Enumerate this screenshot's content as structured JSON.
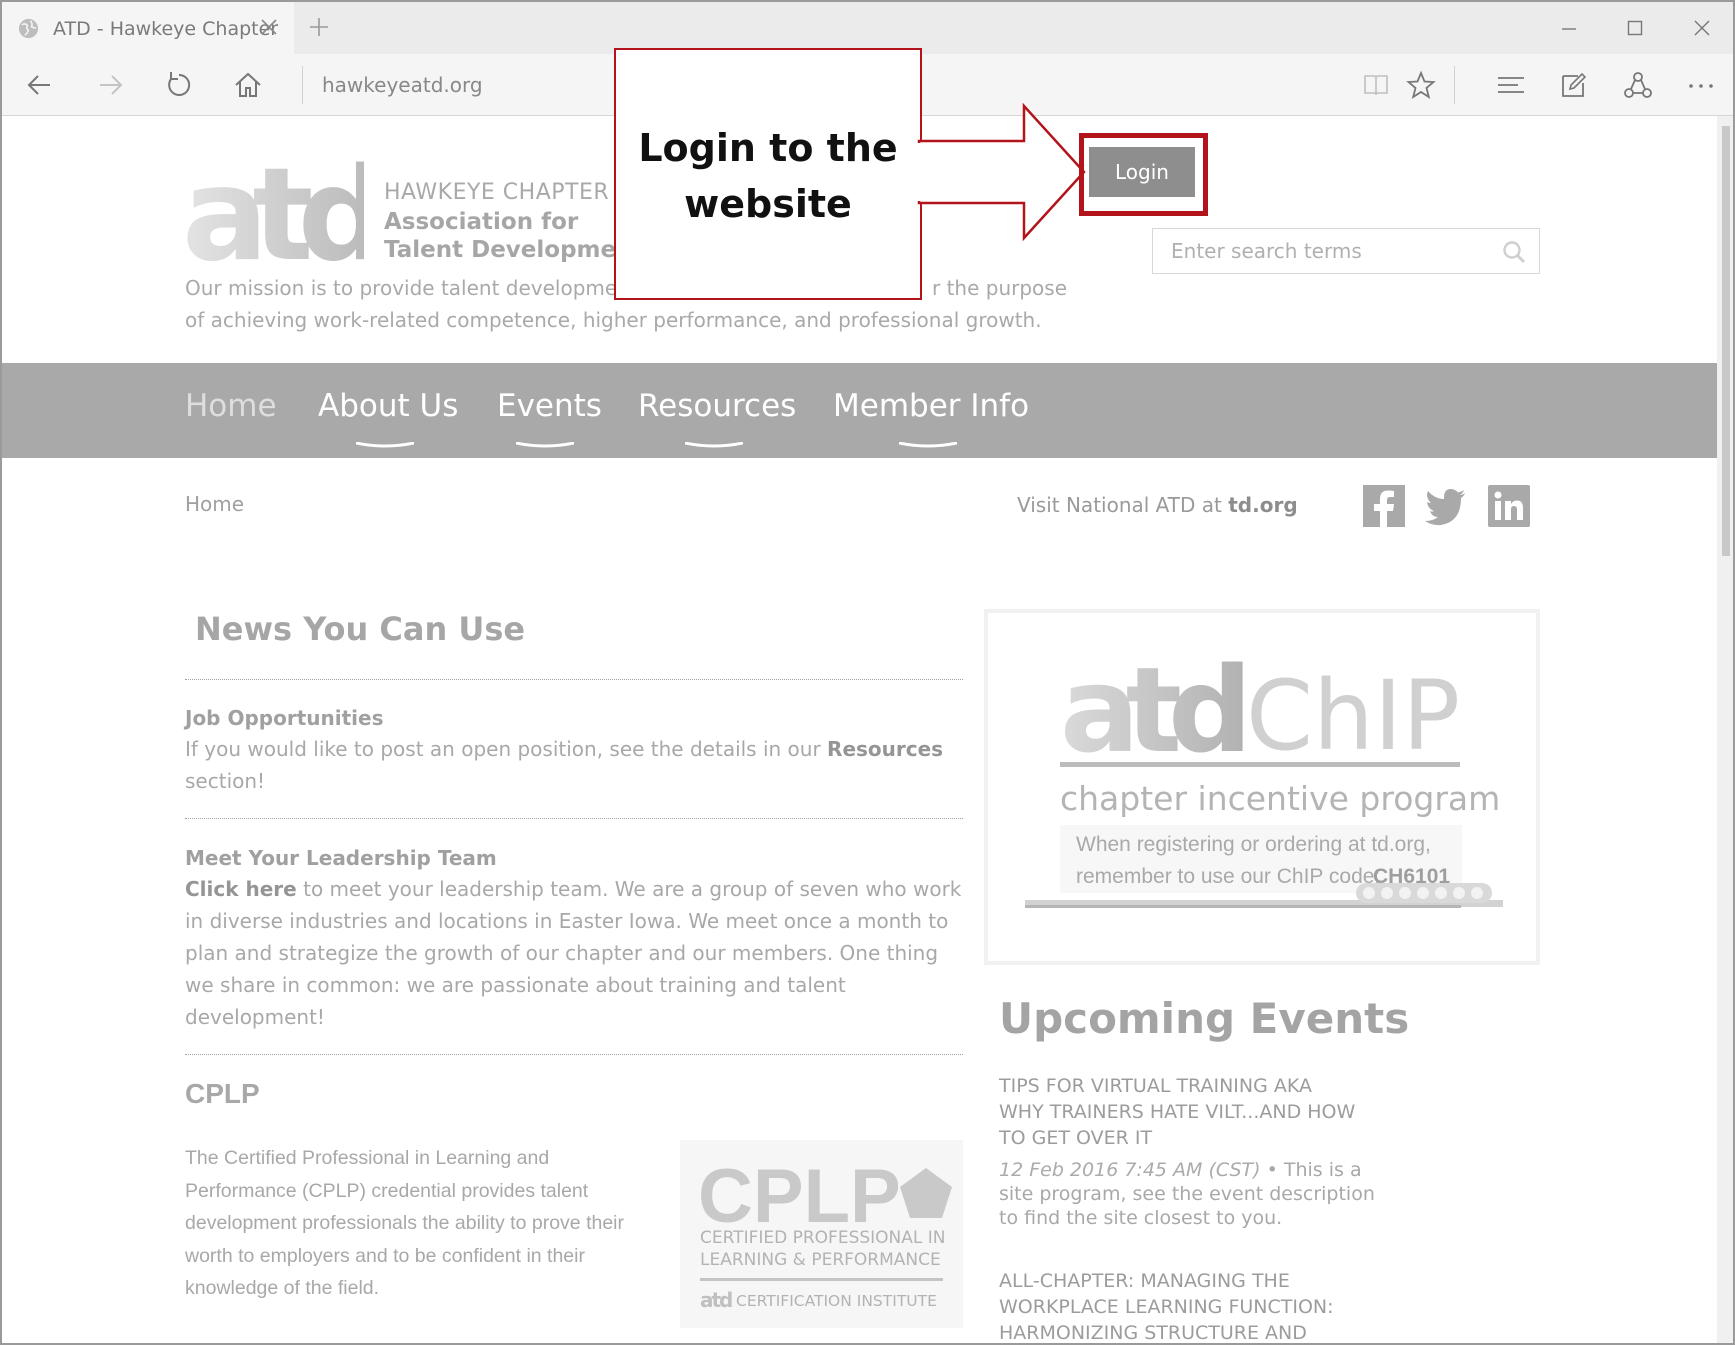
{
  "browser": {
    "tab_title": "ATD - Hawkeye Chapter",
    "address": "hawkeyeatd.org"
  },
  "header": {
    "chapter_line": "HAWKEYE CHAPTER",
    "assoc_line1": "Association for",
    "assoc_line2": "Talent Development",
    "mission_line1": "Our mission is to provide talent development",
    "mission_line1_tail": "r the purpose",
    "mission_line2": "of achieving work-related competence, higher performance, and professional growth.",
    "login_label": "Login",
    "search_placeholder": "Enter search terms"
  },
  "nav": {
    "items": [
      "Home",
      "About Us",
      "Events",
      "Resources",
      "Member Info"
    ]
  },
  "subbar": {
    "breadcrumb": "Home",
    "visit_prefix": "Visit National ATD at ",
    "visit_link": "td.org"
  },
  "news": {
    "title": "News You Can Use",
    "job_head": "Job Opportunities",
    "job_text_pre": "If you would like to post an open position, see the details in our ",
    "job_text_link": "Resources",
    "job_text_post": "section!",
    "team_head": "Meet Your Leadership Team",
    "team_link": "Click here",
    "team_text": " to meet your leadership team. We are a group of seven who work in diverse industries and locations in Easter Iowa. We meet once a month to plan and strategize the growth of our chapter and our members. One thing we share in common: we are passionate about training and talent development!"
  },
  "cplp": {
    "title": "CPLP",
    "text": "The Certified Professional in Learning and Performance (CPLP) credential provides talent development professionals the ability to prove their worth to employers and to be confident in their knowledge of the field.",
    "logo_big": "CPLP",
    "logo_line1": "CERTIFIED PROFESSIONAL IN",
    "logo_line2": "LEARNING & PERFORMANCE",
    "logo_line3": "CERTIFICATION INSTITUTE"
  },
  "chip": {
    "logo_word": "ChIP",
    "subtitle": "chapter incentive program",
    "note_line1": "When registering or ordering at td.org,",
    "note_line2_pre": "remember to use our ChIP code: ",
    "note_code": "CH6101"
  },
  "events": {
    "title": "Upcoming Events",
    "event1_title": "TIPS FOR VIRTUAL TRAINING AKA WHY TRAINERS HATE VILT...AND HOW TO GET OVER IT",
    "event1_date": "12 Feb 2016 7:45 AM (CST)",
    "event1_desc": " • This is a site program, see the event description to find the site closest to you.",
    "event2_title": "ALL-CHAPTER: MANAGING THE WORKPLACE LEARNING FUNCTION: HARMONIZING STRUCTURE AND"
  },
  "callout": {
    "line1": "Login to the",
    "line2": "website"
  },
  "colors": {
    "accent_red": "#b3141c",
    "nav_band": "#a9a9a9",
    "login_button": "#8e8e8e"
  }
}
